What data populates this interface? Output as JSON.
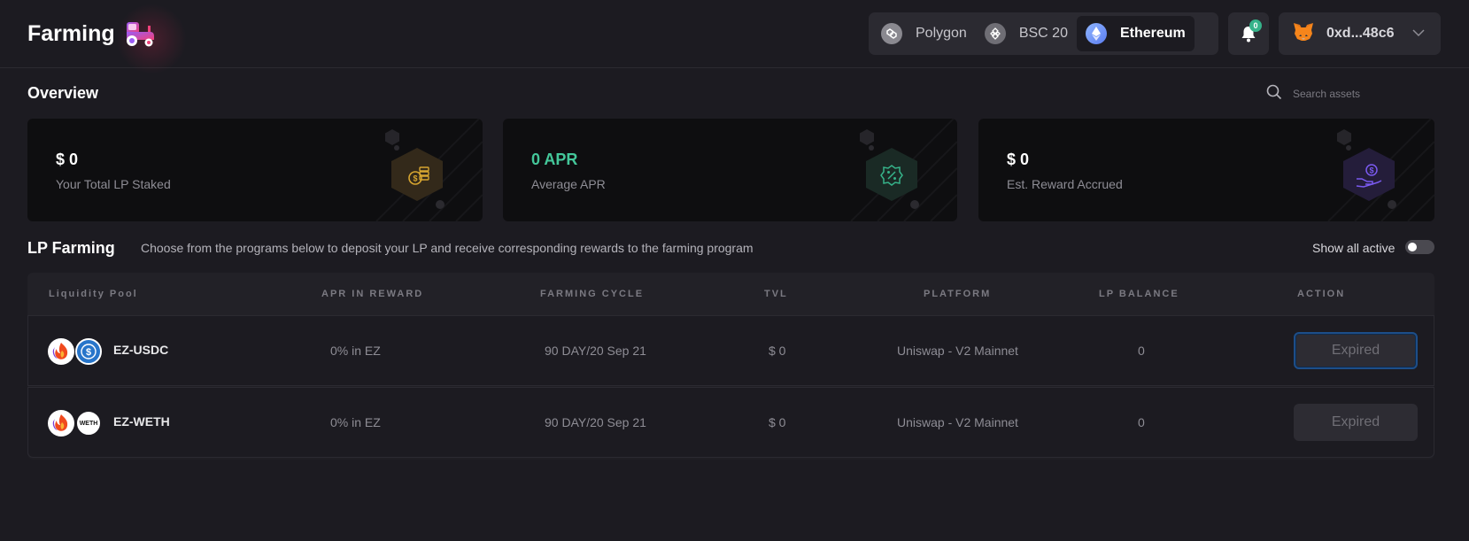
{
  "header": {
    "title": "Farming",
    "networks": [
      {
        "label": "Polygon",
        "icon": "polygon-icon",
        "active": false
      },
      {
        "label": "BSC 20",
        "icon": "bsc-icon",
        "active": false
      },
      {
        "label": "Ethereum",
        "icon": "ethereum-icon",
        "active": true
      }
    ],
    "notifications_count": "0",
    "wallet_address": "0xd...48c6"
  },
  "overview": {
    "title": "Overview",
    "search_placeholder": "Search assets",
    "cards": [
      {
        "value": "$ 0",
        "label": "Your Total LP Staked",
        "icon": "coins-icon",
        "accent": "#d8a630"
      },
      {
        "value": "0 APR",
        "label": "Average APR",
        "icon": "percent-badge-icon",
        "accent": "#36b38a"
      },
      {
        "value": "$ 0",
        "label": "Est. Reward Accrued",
        "icon": "hand-coin-icon",
        "accent": "#7a5af0"
      }
    ]
  },
  "lp_farming": {
    "title": "LP Farming",
    "description": "Choose from the programs below to deposit your LP and receive corresponding rewards to the farming program",
    "show_all_label": "Show all active",
    "show_all_on": false,
    "columns": [
      "Liquidity Pool",
      "APR IN REWARD",
      "FARMING CYCLE",
      "TVL",
      "PLATFORM",
      "LP BALANCE",
      "ACTION"
    ],
    "rows": [
      {
        "pool": "EZ-USDC",
        "apr": "0% in EZ",
        "cycle": "90 DAY/20 Sep 21",
        "tvl": "$ 0",
        "platform": "Uniswap - V2 Mainnet",
        "balance": "0",
        "action": "Expired"
      },
      {
        "pool": "EZ-WETH",
        "apr": "0% in EZ",
        "cycle": "90 DAY/20 Sep 21",
        "tvl": "$ 0",
        "platform": "Uniswap - V2 Mainnet",
        "balance": "0",
        "action": "Expired"
      }
    ],
    "weth_badge": "WETH"
  },
  "colors": {
    "background": "#1c1b21",
    "card": "#0e0e10",
    "green": "#44c79a",
    "badge_green": "#36b38a"
  }
}
